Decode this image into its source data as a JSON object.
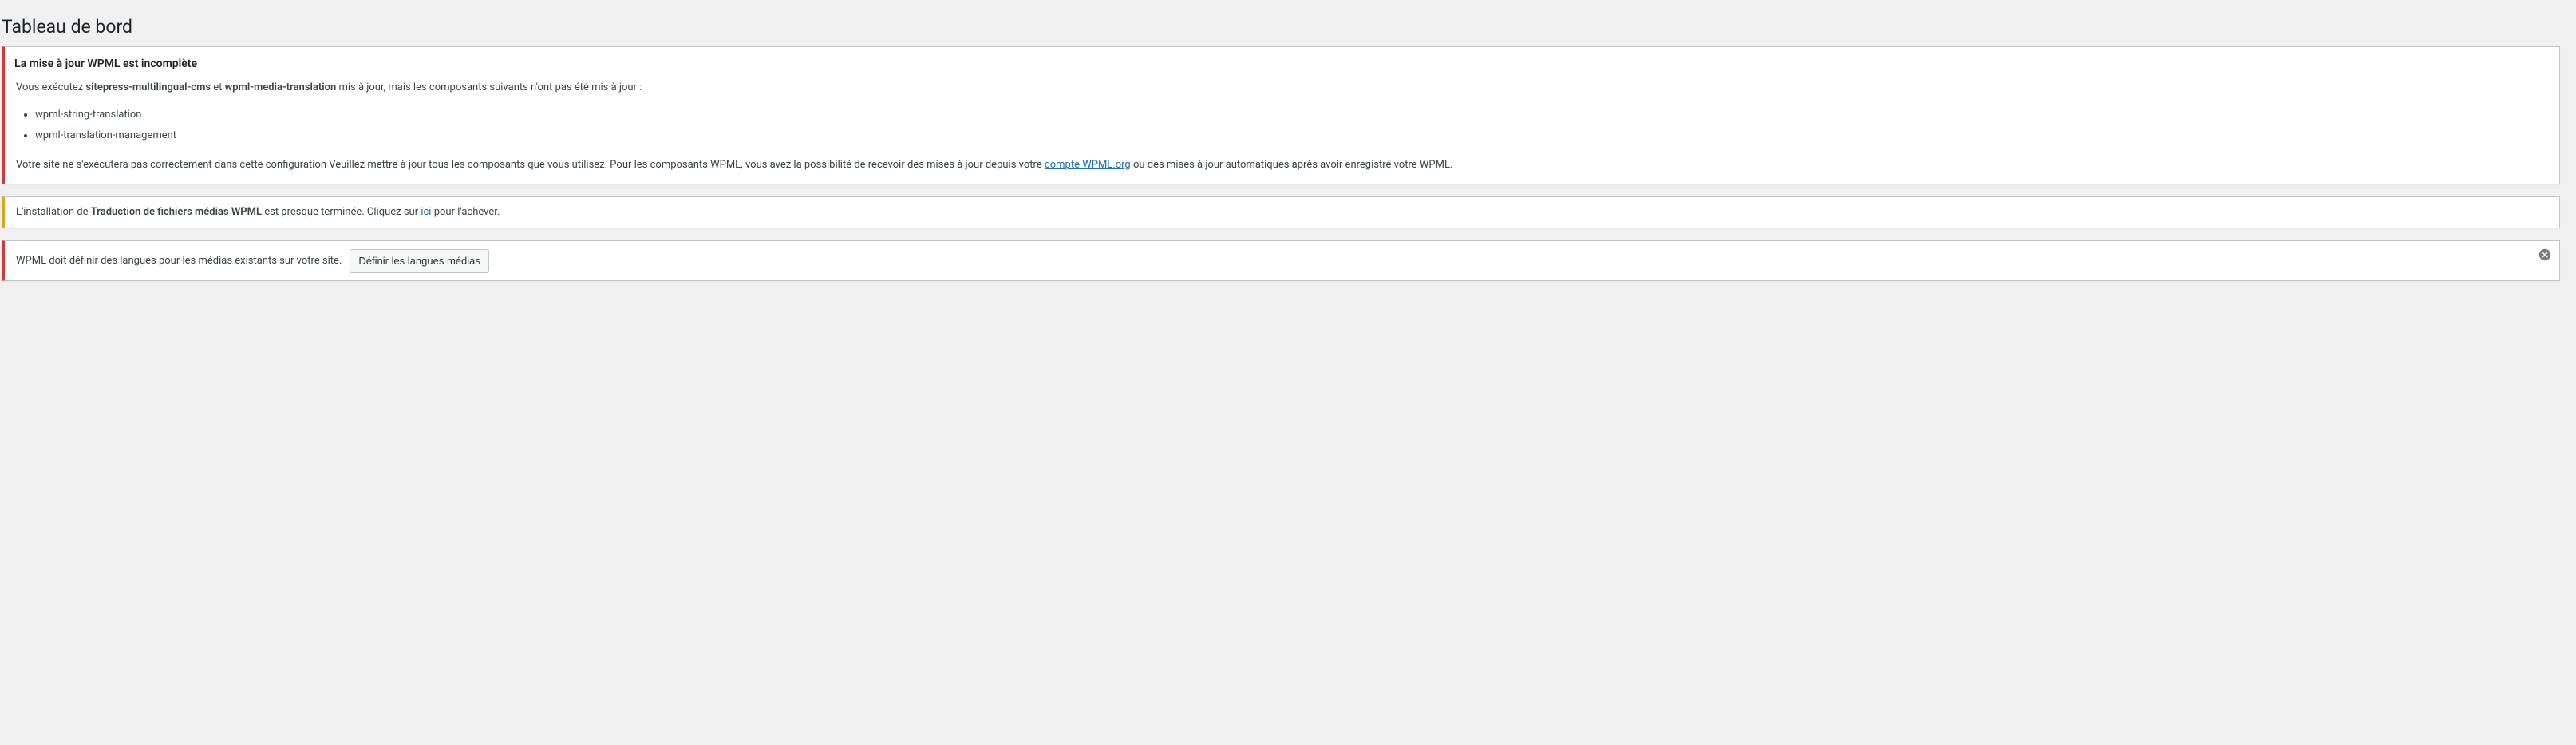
{
  "page": {
    "title": "Tableau de bord"
  },
  "notices": {
    "wpml_incomplete": {
      "heading": "La mise à jour WPML est incomplète",
      "intro_prefix": "Vous exécutez ",
      "intro_comp1": "sitepress-multilingual-cms",
      "intro_mid": " et ",
      "intro_comp2": "wpml-media-translation",
      "intro_suffix": " mis à jour, mais les composants suivants n'ont pas été mis à jour :",
      "items": [
        "wpml-string-translation",
        "wpml-translation-management"
      ],
      "outro_prefix": "Votre site ne s'exécutera pas correctement dans cette configuration Veuillez mettre à jour tous les composants que vous utilisez. Pour les composants WPML, vous avez la possibilité de recevoir des mises à jour depuis votre ",
      "outro_link": "compte WPML.org",
      "outro_suffix": " ou des mises à jour automatiques après avoir enregistré votre WPML."
    },
    "media_translation": {
      "prefix": "L'installation de ",
      "bold": "Traduction de fichiers médias WPML",
      "mid": " est presque terminée. Cliquez sur ",
      "link": "ici",
      "suffix": " pour l'achever."
    },
    "media_languages": {
      "text": "WPML doit définir des langues pour les médias existants sur votre site.",
      "button": "Définir les langues médias",
      "dismiss_label": "Ignorer cette notification"
    }
  }
}
